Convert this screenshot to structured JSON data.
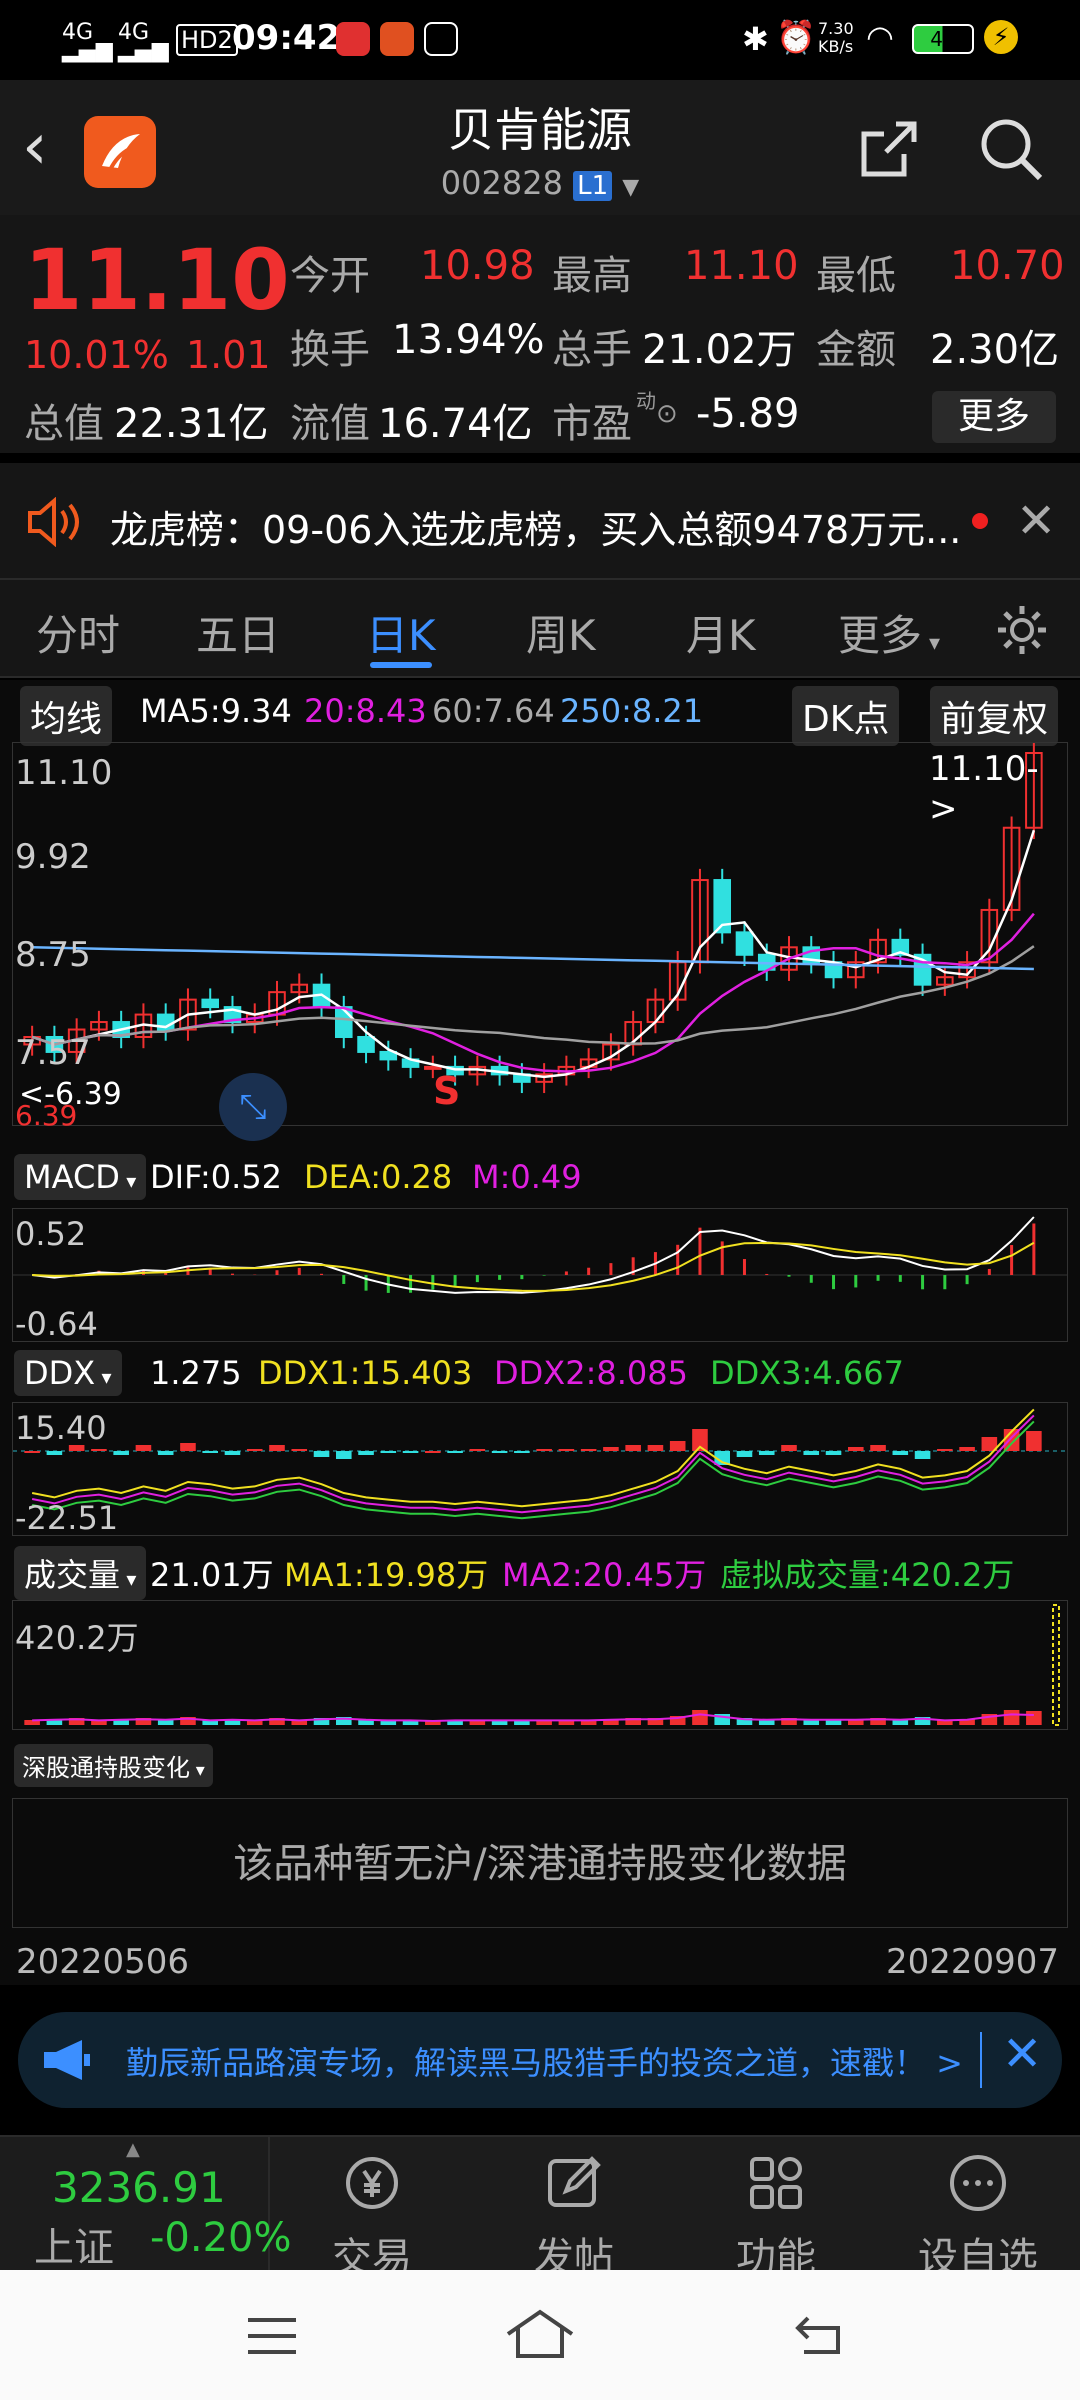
{
  "status": {
    "network1": "4G",
    "network2": "4G",
    "hd": "HD2",
    "time": "09:42",
    "speed_value": "7.30",
    "speed_unit": "KB/s",
    "battery": "49"
  },
  "header": {
    "title": "贝肯能源",
    "code": "002828",
    "level": "L1"
  },
  "quote": {
    "price": "11.10",
    "change_pct": "10.01%",
    "change_abs": "1.01",
    "open_label": "今开",
    "open": "10.98",
    "high_label": "最高",
    "high": "11.10",
    "low_label": "最低",
    "low": "10.70",
    "turnover_label": "换手",
    "turnover": "13.94%",
    "volume_label": "总手",
    "volume": "21.02万",
    "amount_label": "金额",
    "amount": "2.30亿",
    "mktcap_label": "总值",
    "mktcap": "22.31亿",
    "float_label": "流值",
    "float": "16.74亿",
    "pe_label": "市盈",
    "pe_sup": "动",
    "pe": "-5.89",
    "more_label": "更多"
  },
  "notice": {
    "text": "龙虎榜：09-06入选龙虎榜，买入总额9478万元..."
  },
  "tabs": [
    "分时",
    "五日",
    "日K",
    "周K",
    "月K",
    "更多"
  ],
  "tab_active": "日K",
  "ma_bar": {
    "btn": "均线",
    "ma5": "MA5:9.34",
    "ma20": "20:8.43",
    "ma60": "60:7.64",
    "ma250": "250:8.21",
    "dk": "DK点",
    "fq": "前复权"
  },
  "kline": {
    "y_top": "11.10",
    "y2": "9.92",
    "y3": "8.75",
    "y4": "7.57",
    "y_low": "6.39",
    "last_tag": "11.10->",
    "low_tag": "<-6.39",
    "signal": "S"
  },
  "macd": {
    "btn": "MACD",
    "dif": "DIF:0.52",
    "dea": "DEA:0.28",
    "m": "M:0.49",
    "y_top": "0.52",
    "y_bot": "-0.64"
  },
  "ddx": {
    "btn": "DDX",
    "v": "1.275",
    "ddx1": "DDX1:15.403",
    "ddx2": "DDX2:8.085",
    "ddx3": "DDX3:4.667",
    "y_top": "15.40",
    "y_bot": "-22.51"
  },
  "vol": {
    "btn": "成交量",
    "v": "21.01万",
    "ma1": "MA1:19.98万",
    "ma2": "MA2:20.45万",
    "virt": "虚拟成交量:420.2万",
    "y_top": "420.2万"
  },
  "hk": {
    "btn": "深股通持股变化",
    "empty": "该品种暂无沪/深港通持股变化数据"
  },
  "dates": {
    "start": "20220506",
    "end": "20220907"
  },
  "ad": {
    "text": "勤辰新品路演专场，解读黑马股猎手的投资之道，速戳！ >"
  },
  "bottom": {
    "index_value": "3236.91",
    "index_name": "上证",
    "index_change": "-0.20%",
    "trade": "交易",
    "post": "发帖",
    "func": "功能",
    "fav": "设自选"
  },
  "chart_data": {
    "type": "candlestick",
    "title": "贝肯能源 日K",
    "x_range": [
      "20220506",
      "20220907"
    ],
    "ylim": [
      6.39,
      11.1
    ],
    "y_ticks": [
      11.1,
      9.92,
      8.75,
      7.57,
      6.39
    ],
    "last_close": 11.1,
    "ma": {
      "MA5": 9.34,
      "MA20": 8.43,
      "MA60": 7.64,
      "MA250": 8.21
    },
    "close_series": [
      7.3,
      7.1,
      7.4,
      7.5,
      7.3,
      7.6,
      7.4,
      7.8,
      7.7,
      7.5,
      7.6,
      7.9,
      8.0,
      7.7,
      7.3,
      7.1,
      7.0,
      6.9,
      6.9,
      6.8,
      6.9,
      6.8,
      6.7,
      6.8,
      6.9,
      7.0,
      7.2,
      7.5,
      7.8,
      8.3,
      9.4,
      8.7,
      8.4,
      8.2,
      8.5,
      8.3,
      8.1,
      8.3,
      8.6,
      8.4,
      8.0,
      8.1,
      8.3,
      9.0,
      10.1,
      11.1
    ],
    "colors": {
      "up": "#f03030",
      "down": "#30e0e0",
      "ma5": "#ffffff",
      "ma20": "#e020e0",
      "ma60": "#a0a0a0",
      "ma250": "#6ab4ff"
    }
  }
}
